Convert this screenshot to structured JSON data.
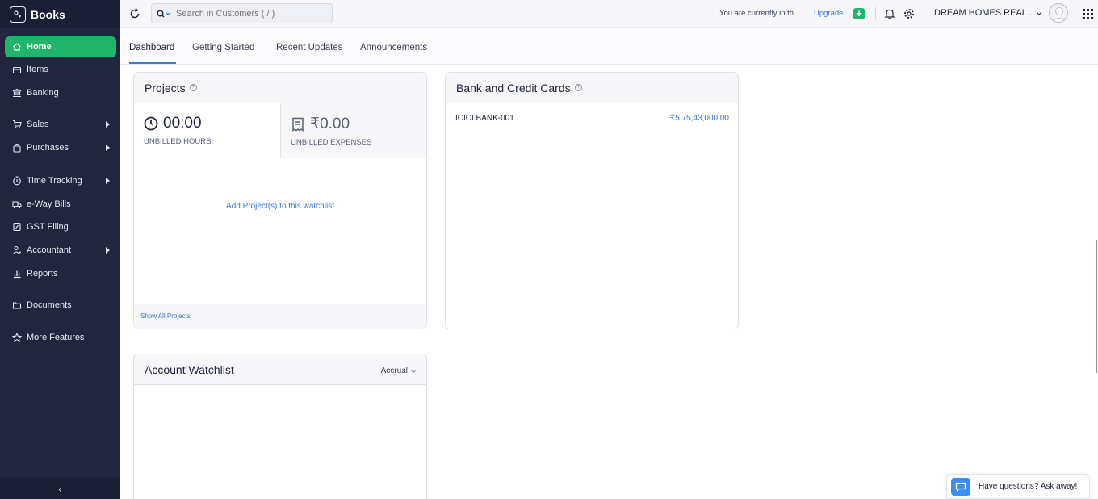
{
  "app": {
    "name": "Books"
  },
  "sidebar": {
    "items": [
      {
        "label": "Home",
        "icon": "home-icon",
        "active": true
      },
      {
        "label": "Items",
        "icon": "items-icon"
      },
      {
        "label": "Banking",
        "icon": "bank-icon"
      },
      {
        "label": "Sales",
        "icon": "cart-icon",
        "has_submenu": true
      },
      {
        "label": "Purchases",
        "icon": "bag-icon",
        "has_submenu": true
      },
      {
        "label": "Time Tracking",
        "icon": "clock-icon",
        "has_submenu": true
      },
      {
        "label": "e-Way Bills",
        "icon": "truck-icon"
      },
      {
        "label": "GST Filing",
        "icon": "document-icon"
      },
      {
        "label": "Accountant",
        "icon": "person-icon",
        "has_submenu": true
      },
      {
        "label": "Reports",
        "icon": "bar-chart-icon"
      },
      {
        "label": "Documents",
        "icon": "folder-icon"
      },
      {
        "label": "More Features",
        "icon": "star-icon"
      }
    ],
    "collapse_glyph": "‹"
  },
  "topbar": {
    "search_placeholder": "Search in Customers ( / )",
    "trial_text": "You are currently in th...",
    "upgrade_label": "Upgrade",
    "plus_glyph": "+",
    "org_name": "DREAM HOMES REAL...",
    "accent": "#21b46c"
  },
  "tabs": [
    {
      "label": "Dashboard",
      "active": true
    },
    {
      "label": "Getting Started"
    },
    {
      "label": "Recent Updates"
    },
    {
      "label": "Announcements"
    }
  ],
  "projects": {
    "title": "Projects",
    "unbilled_hours_value": "00:00",
    "unbilled_hours_label": "UNBILLED HOURS",
    "unbilled_expenses_value": "₹0.00",
    "unbilled_expenses_label": "UNBILLED EXPENSES",
    "add_link": "Add Project(s) to this watchlist",
    "footer_link": "Show All Projects"
  },
  "bank": {
    "title": "Bank and Credit Cards",
    "accounts": [
      {
        "name": "ICICI BANK-001",
        "amount": "₹5,75,43,000.00"
      }
    ]
  },
  "watchlist": {
    "title": "Account Watchlist",
    "basis": "Accrual"
  },
  "help_widget": {
    "text": "Have questions? Ask away!"
  },
  "help_glyph": "?"
}
